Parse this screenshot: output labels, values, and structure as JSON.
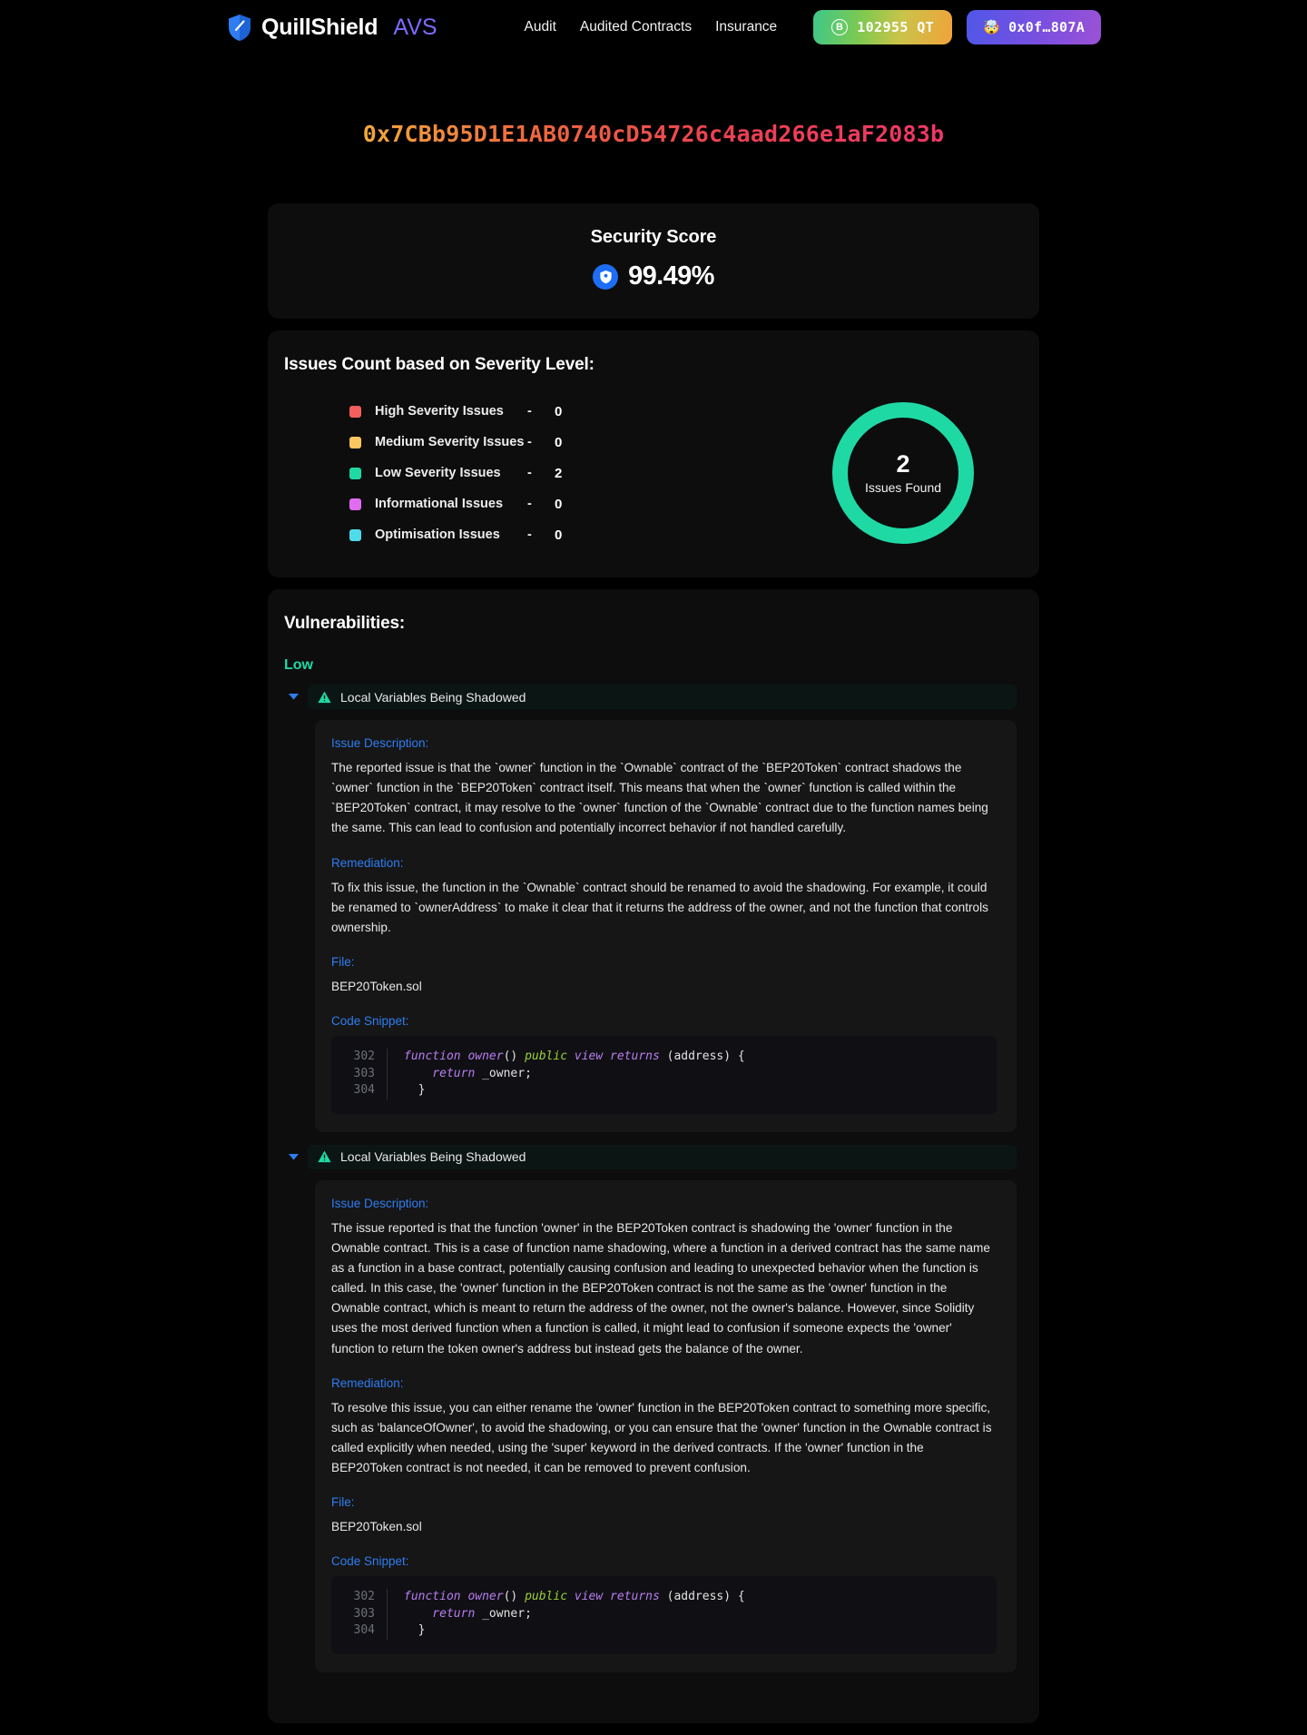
{
  "header": {
    "brand_name": "QuillShield",
    "brand_suffix": "AVS",
    "brand_icon": "shield-icon",
    "nav": [
      {
        "label": "Audit",
        "name": "nav-audit"
      },
      {
        "label": "Audited Contracts",
        "name": "nav-audited-contracts"
      },
      {
        "label": "Insurance",
        "name": "nav-insurance"
      }
    ],
    "token_balance": "102955 QT",
    "token_icon": "bitcoin-icon",
    "wallet_label": "0x0f…807A",
    "wallet_emoji": "🤯"
  },
  "contract": {
    "address": "0x7CBb95D1E1AB0740cD54726c4aad266e1aF2083b"
  },
  "security_score": {
    "title": "Security Score",
    "value": "99.49%",
    "badge_icon": "shield-check-icon"
  },
  "issues_count": {
    "title": "Issues Count based on Severity Level:",
    "separator": "-",
    "rows": [
      {
        "label": "High Severity Issues",
        "count": "0",
        "color": "#f25f5c"
      },
      {
        "label": "Medium Severity Issues",
        "count": "0",
        "color": "#fbc661"
      },
      {
        "label": "Low Severity Issues",
        "count": "2",
        "color": "#1fd9a4"
      },
      {
        "label": "Informational Issues",
        "count": "0",
        "color": "#e06df0"
      },
      {
        "label": "Optimisation Issues",
        "count": "0",
        "color": "#4fdcea"
      }
    ],
    "donut": {
      "number": "2",
      "label": "Issues Found",
      "color": "#1fd9a4"
    }
  },
  "chart_data": {
    "type": "pie",
    "title": "Issues Count based on Severity Level:",
    "categories": [
      "High Severity Issues",
      "Medium Severity Issues",
      "Low Severity Issues",
      "Informational Issues",
      "Optimisation Issues"
    ],
    "values": [
      0,
      0,
      2,
      0,
      0
    ],
    "colors": [
      "#f25f5c",
      "#fbc661",
      "#1fd9a4",
      "#e06df0",
      "#4fdcea"
    ],
    "total": 2,
    "center_label": "Issues Found",
    "legend": "left",
    "donut": true
  },
  "vulnerabilities": {
    "title": "Vulnerabilities:",
    "severity_label": "Low",
    "labels": {
      "description": "Issue Description:",
      "remediation": "Remediation:",
      "file": "File:",
      "code": "Code Snippet:"
    },
    "items": [
      {
        "name": "Local Variables Being Shadowed",
        "description": "The reported issue is that the `owner` function in the `Ownable` contract of the `BEP20Token` contract shadows the `owner` function in the `BEP20Token` contract itself. This means that when the `owner` function is called within the `BEP20Token` contract, it may resolve to the `owner` function of the `Ownable` contract due to the function names being the same. This can lead to confusion and potentially incorrect behavior if not handled carefully.",
        "remediation": "To fix this issue, the function in the `Ownable` contract should be renamed to avoid the shadowing. For example, it could be renamed to `ownerAddress` to make it clear that it returns the address of the owner, and not the function that controls ownership.",
        "file": "BEP20Token.sol",
        "code": {
          "lines": [
            "302",
            "303",
            "304"
          ]
        }
      },
      {
        "name": "Local Variables Being Shadowed",
        "description": "The issue reported is that the function 'owner' in the BEP20Token contract is shadowing the 'owner' function in the Ownable contract. This is a case of function name shadowing, where a function in a derived contract has the same name as a function in a base contract, potentially causing confusion and leading to unexpected behavior when the function is called. In this case, the 'owner' function in the BEP20Token contract is not the same as the 'owner' function in the Ownable contract, which is meant to return the address of the owner, not the owner's balance. However, since Solidity uses the most derived function when a function is called, it might lead to confusion if someone expects the 'owner' function to return the token owner's address but instead gets the balance of the owner.",
        "remediation": "To resolve this issue, you can either rename the 'owner' function in the BEP20Token contract to something more specific, such as 'balanceOfOwner', to avoid the shadowing, or you can ensure that the 'owner' function in the Ownable contract is called explicitly when needed, using the 'super' keyword in the derived contracts. If the 'owner' function in the BEP20Token contract is not needed, it can be removed to prevent confusion.",
        "file": "BEP20Token.sol",
        "code": {
          "lines": [
            "302",
            "303",
            "304"
          ]
        }
      }
    ],
    "code_tokens": {
      "l1_kw": "function",
      "l1_fn": "owner",
      "l1_paren": "() ",
      "l1_mod": "public",
      "l1_mod2": " view returns",
      "l1_tail": " (address) {",
      "l2_kw": "    return",
      "l2_tail": " _owner;",
      "l3_tail": "  }"
    }
  }
}
